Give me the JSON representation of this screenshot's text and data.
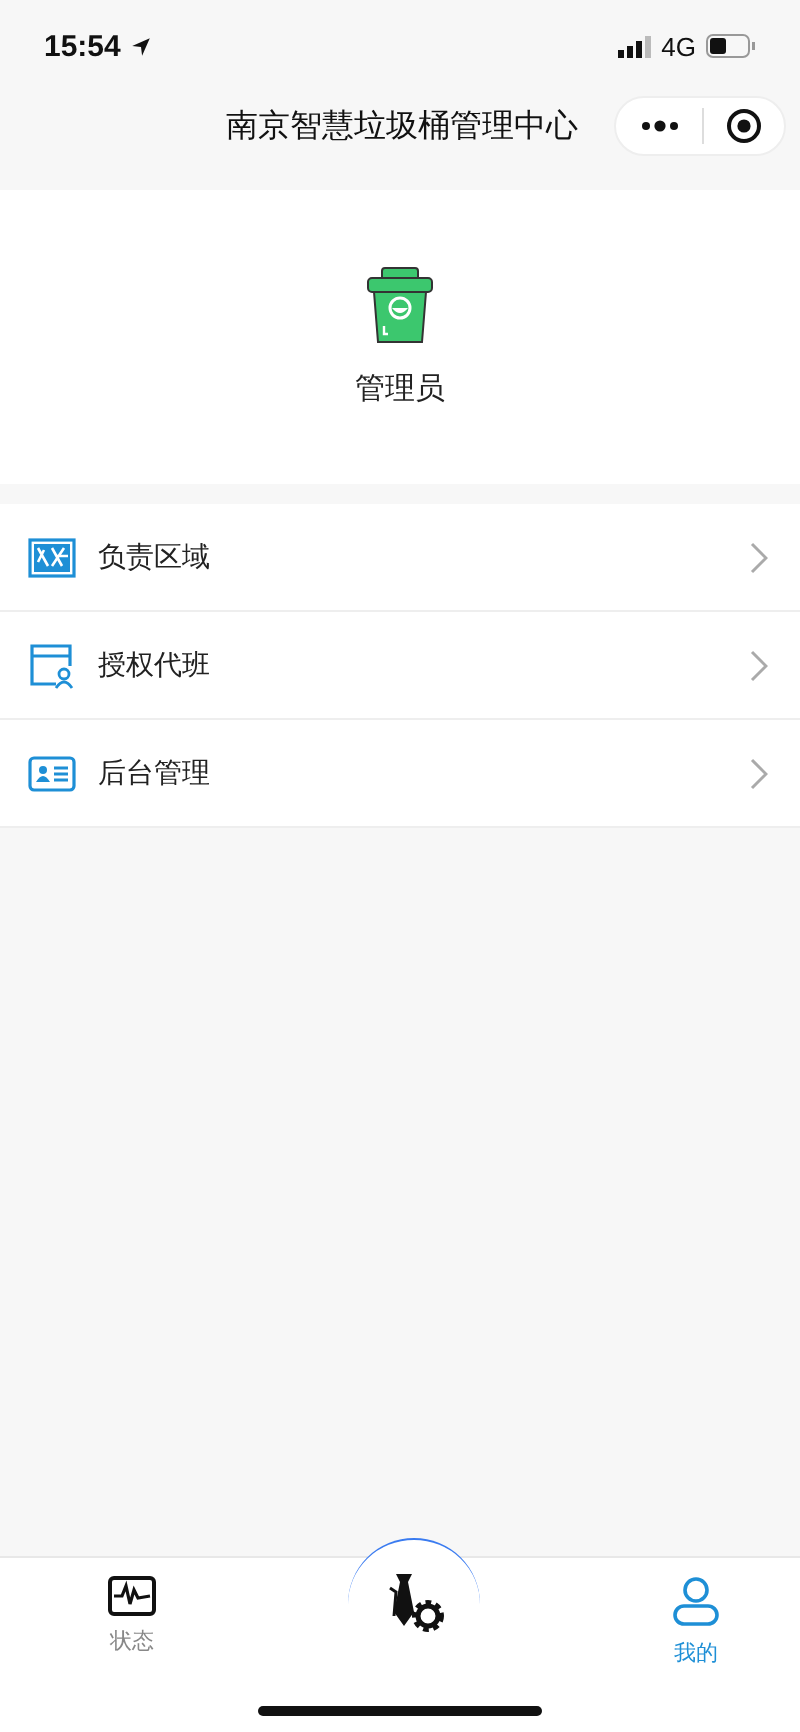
{
  "status_bar": {
    "time": "15:54",
    "network": "4G"
  },
  "nav_bar": {
    "title": "南京智慧垃圾桶管理中心"
  },
  "profile": {
    "role": "管理员"
  },
  "menu": [
    {
      "label": "负责区域"
    },
    {
      "label": "授权代班"
    },
    {
      "label": "后台管理"
    }
  ],
  "tab_bar": [
    {
      "label": "状态",
      "selected": false
    },
    {
      "label": "我的",
      "selected": true
    }
  ]
}
